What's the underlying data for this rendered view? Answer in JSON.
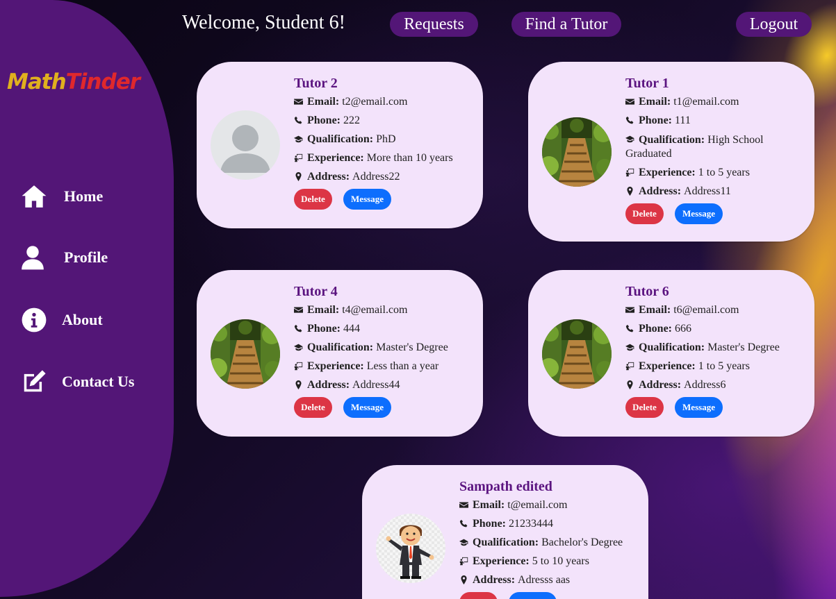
{
  "app": {
    "logo_part1": "Math",
    "logo_part2": "Tinder"
  },
  "header": {
    "welcome": "Welcome, Student 6!",
    "requests_label": "Requests",
    "find_tutor_label": "Find a Tutor",
    "logout_label": "Logout"
  },
  "sidebar": {
    "items": [
      {
        "label": "Home",
        "icon": "home-icon"
      },
      {
        "label": "Profile",
        "icon": "user-icon"
      },
      {
        "label": "About",
        "icon": "info-circle-icon"
      },
      {
        "label": "Contact Us",
        "icon": "edit-square-icon"
      }
    ]
  },
  "labels": {
    "email": "Email:",
    "phone": "Phone:",
    "qualification": "Qualification:",
    "experience": "Experience:",
    "address": "Address:",
    "delete": "Delete",
    "message": "Message"
  },
  "tutors": [
    {
      "name": "Tutor 2",
      "email": "t2@email.com",
      "phone": "222",
      "qualification": "PhD",
      "experience": "More than 10 years",
      "address": "Address22",
      "avatar": "default-avatar"
    },
    {
      "name": "Tutor 1",
      "email": "t1@email.com",
      "phone": "111",
      "qualification": "High School Graduated",
      "experience": "1 to 5 years",
      "address": "Address11",
      "avatar": "forest-path-photo"
    },
    {
      "name": "Tutor 4",
      "email": "t4@email.com",
      "phone": "444",
      "qualification": "Master's Degree",
      "experience": "Less than a year",
      "address": "Address44",
      "avatar": "forest-path-photo"
    },
    {
      "name": "Tutor 6",
      "email": "t6@email.com",
      "phone": "666",
      "qualification": "Master's Degree",
      "experience": "1 to 5 years",
      "address": "Address6",
      "avatar": "forest-path-photo"
    },
    {
      "name": "Sampath edited",
      "email": "t@email.com",
      "phone": "21233444",
      "qualification": "Bachelor's Degree",
      "experience": "5 to 10 years",
      "address": "Adresss aas",
      "avatar": "cartoon-businessman"
    }
  ],
  "colors": {
    "sidebar": "#531677",
    "card_bg": "#f3e3fb",
    "tutor_name": "#5b1480",
    "delete_button": "#dc3545",
    "message_button": "#0d6efd",
    "logo_math": "#e0b01e",
    "logo_tinder": "#e0282c"
  }
}
